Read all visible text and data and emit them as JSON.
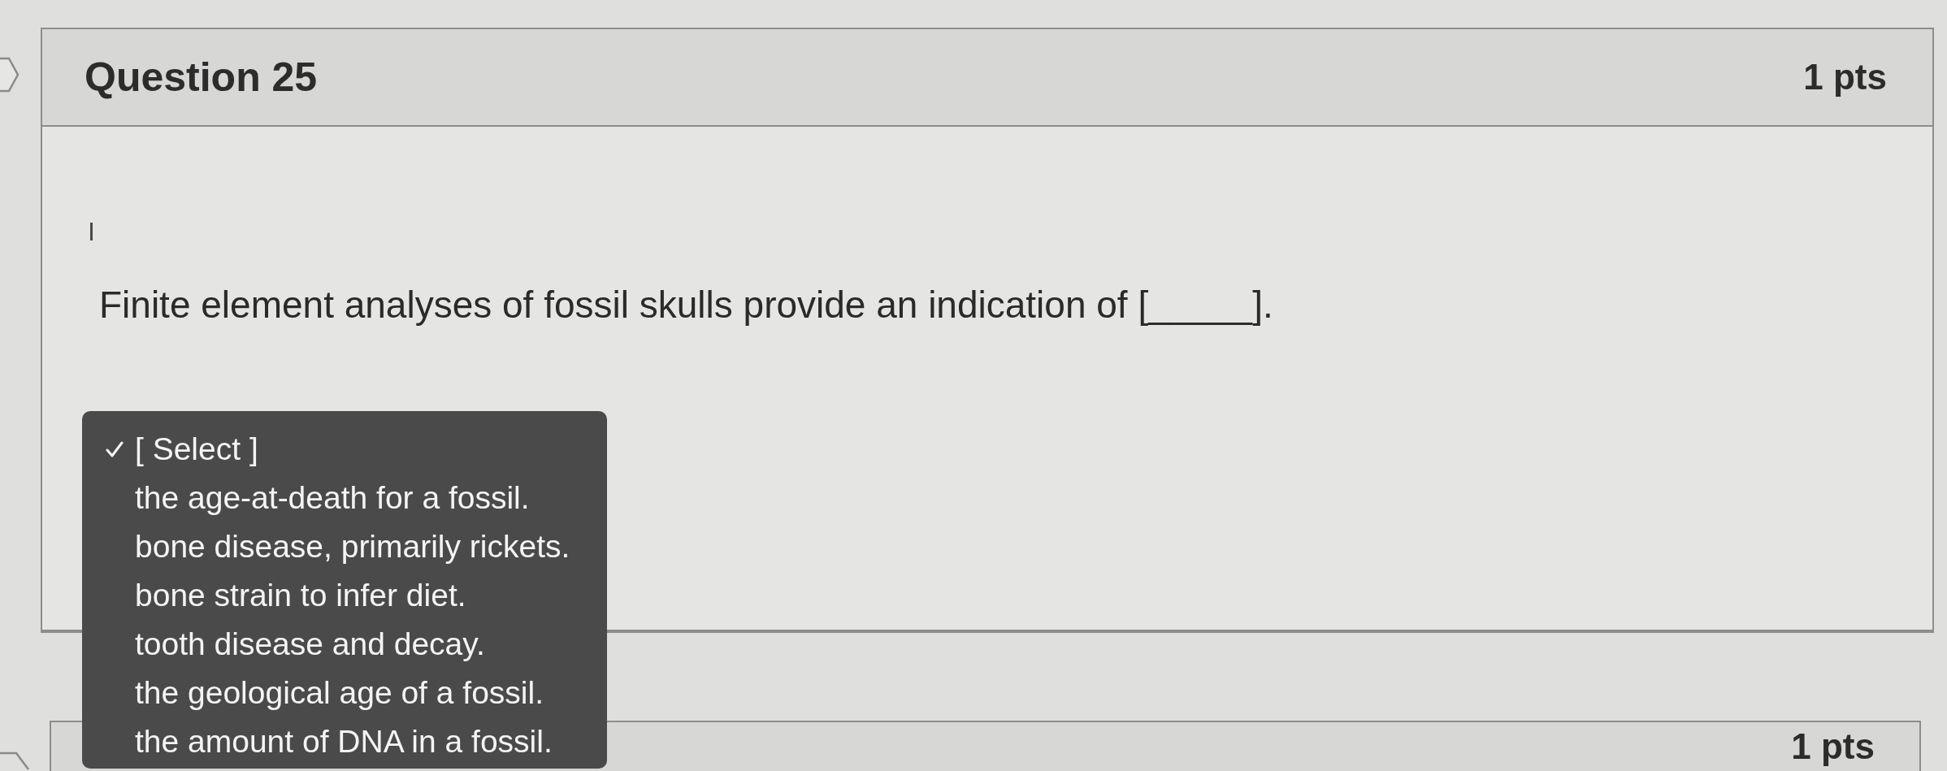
{
  "question": {
    "title": "Question 25",
    "points": "1 pts",
    "text": "Finite element analyses of fossil skulls provide an indication of [_____].",
    "answer_dropdown": {
      "expanded": true,
      "options": [
        {
          "label": "[ Select ]",
          "selected": true
        },
        {
          "label": "the age-at-death for a fossil.",
          "selected": false
        },
        {
          "label": "bone disease, primarily rickets.",
          "selected": false
        },
        {
          "label": "bone strain to infer diet.",
          "selected": false
        },
        {
          "label": "tooth disease and decay.",
          "selected": false
        },
        {
          "label": "the geological age of a fossil.",
          "selected": false
        },
        {
          "label": "the amount of DNA in a fossil.",
          "selected": false
        }
      ]
    }
  },
  "next_question": {
    "points": "1 pts"
  }
}
